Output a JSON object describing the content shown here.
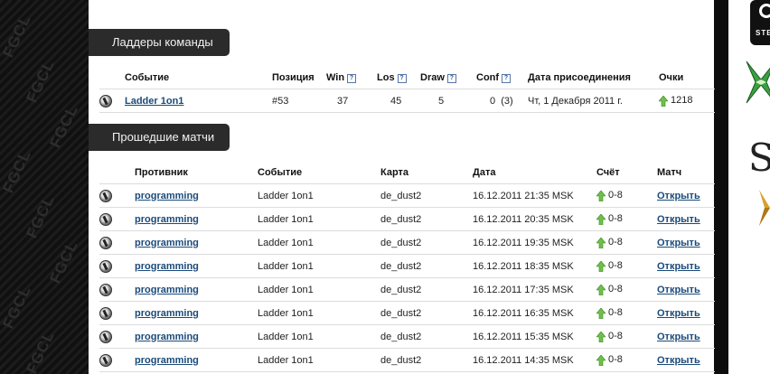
{
  "ladders": {
    "title": "Ладдеры команды",
    "columns": {
      "event": "Событие",
      "position": "Позиция",
      "win": "Win",
      "los": "Los",
      "draw": "Draw",
      "conf": "Conf",
      "joined": "Дата присоединения",
      "points": "Очки"
    },
    "help_glyph": "?",
    "rows": [
      {
        "event": "Ladder 1on1",
        "position": "#53",
        "win": "37",
        "los": "45",
        "draw": "5",
        "conf": "0",
        "conf_extra": "(3)",
        "joined": "Чт, 1 Декабря 2011 г.",
        "points": "1218"
      }
    ]
  },
  "matches": {
    "title": "Прошедшие матчи",
    "columns": {
      "opponent": "Противник",
      "event": "Событие",
      "map": "Карта",
      "date": "Дата",
      "score": "Счёт",
      "match": "Матч"
    },
    "rows": [
      {
        "opponent": "programming",
        "event": "Ladder 1on1",
        "map": "de_dust2",
        "date": "16.12.2011 21:35 MSK",
        "score": "0-8",
        "link": "Открыть"
      },
      {
        "opponent": "programming",
        "event": "Ladder 1on1",
        "map": "de_dust2",
        "date": "16.12.2011 20:35 MSK",
        "score": "0-8",
        "link": "Открыть"
      },
      {
        "opponent": "programming",
        "event": "Ladder 1on1",
        "map": "de_dust2",
        "date": "16.12.2011 19:35 MSK",
        "score": "0-8",
        "link": "Открыть"
      },
      {
        "opponent": "programming",
        "event": "Ladder 1on1",
        "map": "de_dust2",
        "date": "16.12.2011 18:35 MSK",
        "score": "0-8",
        "link": "Открыть"
      },
      {
        "opponent": "programming",
        "event": "Ladder 1on1",
        "map": "de_dust2",
        "date": "16.12.2011 17:35 MSK",
        "score": "0-8",
        "link": "Открыть"
      },
      {
        "opponent": "programming",
        "event": "Ladder 1on1",
        "map": "de_dust2",
        "date": "16.12.2011 16:35 MSK",
        "score": "0-8",
        "link": "Открыть"
      },
      {
        "opponent": "programming",
        "event": "Ladder 1on1",
        "map": "de_dust2",
        "date": "16.12.2011 15:35 MSK",
        "score": "0-8",
        "link": "Открыть"
      },
      {
        "opponent": "programming",
        "event": "Ladder 1on1",
        "map": "de_dust2",
        "date": "16.12.2011 14:35 MSK",
        "score": "0-8",
        "link": "Открыть"
      }
    ]
  },
  "sidebar": {
    "watermark": "FGCL",
    "steam_label": "STE",
    "big_letter": "S"
  },
  "colors": {
    "accent_link": "#1a4a7a",
    "header_bg": "#2b2b2b",
    "up_arrow": "#6fbf4a"
  },
  "icons": {
    "game": "cs-game-icon",
    "up": "green-up-arrow-icon",
    "help": "help-question-icon"
  }
}
